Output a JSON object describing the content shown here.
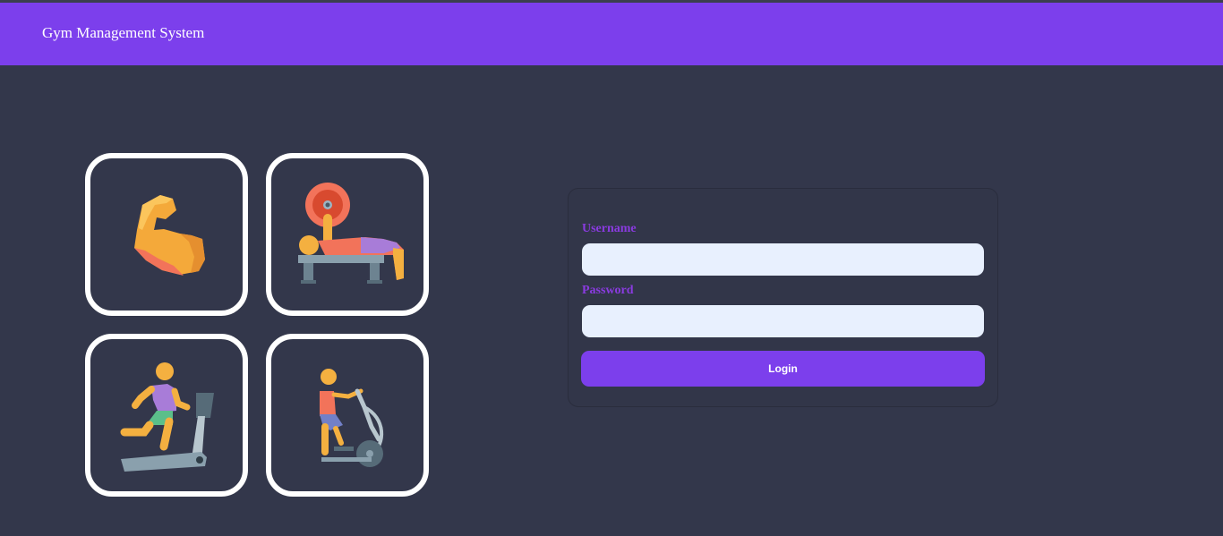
{
  "header": {
    "brand": "Gym Management System"
  },
  "tiles": [
    {
      "icon": "flexed-bicep-icon"
    },
    {
      "icon": "bench-press-icon"
    },
    {
      "icon": "treadmill-runner-icon"
    },
    {
      "icon": "elliptical-trainer-icon"
    }
  ],
  "login": {
    "username_label": "Username",
    "username_value": "",
    "username_placeholder": "",
    "password_label": "Password",
    "password_value": "",
    "button_label": "Login"
  },
  "colors": {
    "accent": "#7c3fec",
    "background": "#33374b",
    "label": "#8a3be0",
    "input_bg": "#e8f0fe"
  }
}
